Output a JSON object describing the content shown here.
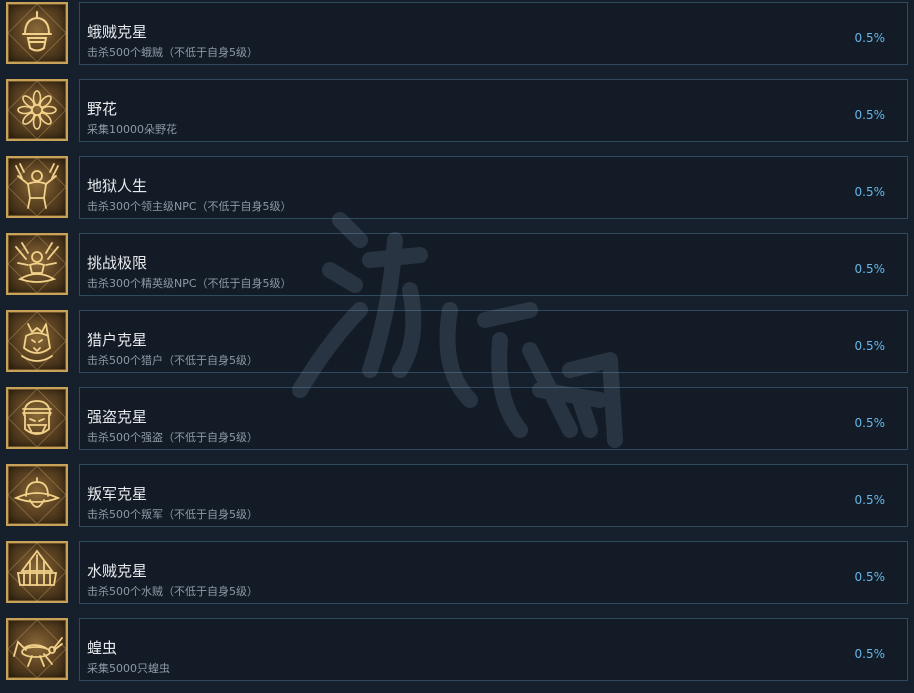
{
  "achievements": [
    {
      "title": "蛾贼克星",
      "desc": "击杀500个蛾贼（不低于自身5级）",
      "percent": "0.5%",
      "icon": "bandit-helmet-icon"
    },
    {
      "title": "野花",
      "desc": "采集10000朵野花",
      "percent": "0.5%",
      "icon": "flower-icon"
    },
    {
      "title": "地狱人生",
      "desc": "击杀300个领主级NPC（不低于自身5级）",
      "percent": "0.5%",
      "icon": "warrior-icon"
    },
    {
      "title": "挑战极限",
      "desc": "击杀300个精英级NPC（不低于自身5级）",
      "percent": "0.5%",
      "icon": "meditating-fighter-icon"
    },
    {
      "title": "猎户克星",
      "desc": "击杀500个猎户（不低于自身5级）",
      "percent": "0.5%",
      "icon": "wolf-hood-icon"
    },
    {
      "title": "强盗克星",
      "desc": "击杀500个强盗（不低于自身5级）",
      "percent": "0.5%",
      "icon": "masked-bandit-icon"
    },
    {
      "title": "叛军克星",
      "desc": "击杀500个叛军（不低于自身5级）",
      "percent": "0.5%",
      "icon": "rebel-hat-icon"
    },
    {
      "title": "水贼克星",
      "desc": "击杀500个水贼（不低于自身5级）",
      "percent": "0.5%",
      "icon": "straw-hat-icon"
    },
    {
      "title": "蝗虫",
      "desc": "采集5000只蝗虫",
      "percent": "0.5%",
      "icon": "locust-icon"
    }
  ],
  "colors": {
    "background": "#16202c",
    "card_border": "#2f4a5f",
    "gold_frame": "#c9a25a",
    "percent_blue": "#67b7ea"
  }
}
